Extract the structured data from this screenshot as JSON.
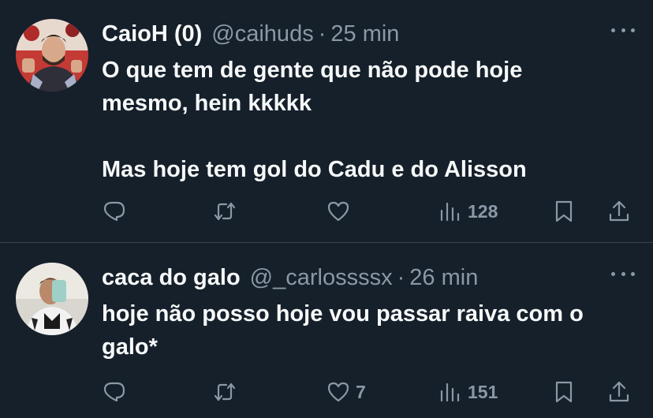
{
  "colors": {
    "background": "#15202b",
    "text_primary": "#f7f9f9",
    "text_secondary": "#8b98a5",
    "divider": "#38444d"
  },
  "tweets": [
    {
      "name": "CaioH (0)",
      "handle": "@caihuds",
      "separator": "·",
      "time": "25 min",
      "text": "O que tem de gente que não pode hoje\nmesmo, hein kkkkk\n\nMas hoje tem gol do Cadu e do Alisson",
      "replies": "",
      "retweets": "",
      "likes": "",
      "views": "128",
      "icons": [
        "reply-icon",
        "retweet-icon",
        "like-icon",
        "views-icon",
        "bookmark-icon",
        "share-icon",
        "more-icon"
      ]
    },
    {
      "name": "caca do galo",
      "handle": "@_carlossssx",
      "separator": "·",
      "time": "26 min",
      "text": "hoje não posso hoje vou passar raiva com o\ngalo*",
      "replies": "",
      "retweets": "",
      "likes": "7",
      "views": "151",
      "icons": [
        "reply-icon",
        "retweet-icon",
        "like-icon",
        "views-icon",
        "bookmark-icon",
        "share-icon",
        "more-icon"
      ]
    }
  ]
}
